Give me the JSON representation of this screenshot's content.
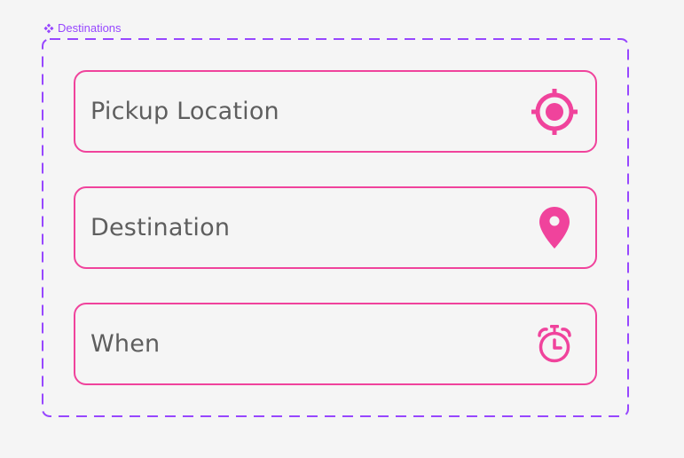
{
  "component": {
    "label": "Destinations",
    "label_icon": "component-diamond-icon",
    "frame_color": "#9747ff"
  },
  "accent_color": "#f0439c",
  "fields": [
    {
      "label": "Pickup Location",
      "icon": "crosshair-target-icon"
    },
    {
      "label": "Destination",
      "icon": "map-pin-icon"
    },
    {
      "label": "When",
      "icon": "alarm-clock-icon"
    }
  ]
}
